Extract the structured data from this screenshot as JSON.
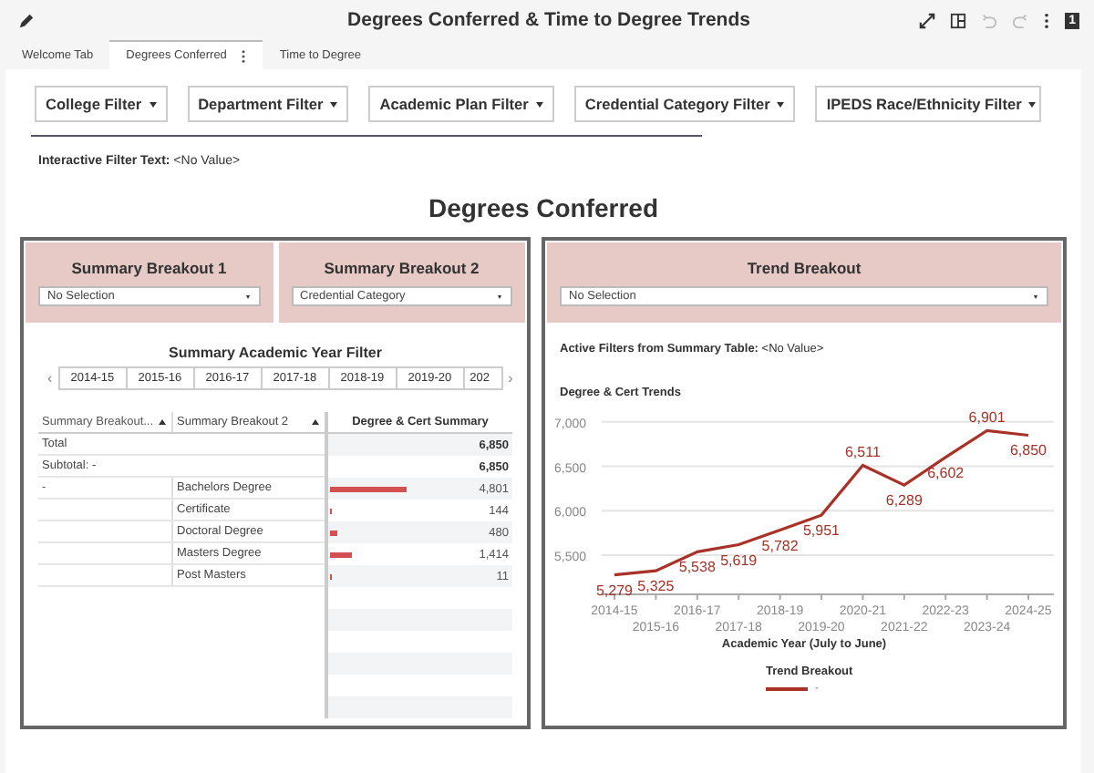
{
  "header": {
    "title": "Degrees Conferred & Time to Degree Trends",
    "page_badge": "1"
  },
  "tabs": [
    {
      "label": "Welcome Tab",
      "selected": false
    },
    {
      "label": "Degrees Conferred",
      "selected": true
    },
    {
      "label": "Time to Degree",
      "selected": false
    }
  ],
  "filters": [
    "College Filter",
    "Department Filter",
    "Academic Plan Filter",
    "Credential Category Filter",
    "IPEDS Race/Ethnicity Filter"
  ],
  "interactive_filter": {
    "label": "Interactive Filter Text:",
    "value": "<No Value>"
  },
  "section_title": "Degrees Conferred",
  "left_panel": {
    "breakouts": [
      {
        "title": "Summary Breakout 1",
        "value": "No Selection"
      },
      {
        "title": "Summary Breakout 2",
        "value": "Credential Category"
      }
    ],
    "year_filter": {
      "title": "Summary Academic Year Filter",
      "prev": "‹",
      "next": "›",
      "years": [
        "2014-15",
        "2015-16",
        "2016-17",
        "2017-18",
        "2018-19",
        "2019-20",
        "202"
      ]
    },
    "table": {
      "columns": [
        "Summary Breakout...",
        "Summary Breakout 2",
        "Degree & Cert Summary"
      ],
      "rows": [
        {
          "kind": "total",
          "label": "Total",
          "value": "6,850"
        },
        {
          "kind": "total",
          "label": "Subtotal: -",
          "value": "6,850"
        },
        {
          "kind": "detail",
          "group": "-",
          "label": "Bachelors Degree",
          "value": "4,801"
        },
        {
          "kind": "detail",
          "label": "Certificate",
          "value": "144"
        },
        {
          "kind": "detail",
          "label": "Doctoral Degree",
          "value": "480"
        },
        {
          "kind": "detail",
          "label": "Masters Degree",
          "value": "1,414"
        },
        {
          "kind": "detail",
          "label": "Post Masters",
          "value": "11"
        }
      ]
    }
  },
  "right_panel": {
    "breakout": {
      "title": "Trend Breakout",
      "value": "No Selection"
    },
    "active_filters": {
      "label": "Active Filters from Summary Table:",
      "value": "<No Value>"
    },
    "chart_data": {
      "type": "line",
      "title": "Degree & Cert Trends",
      "xlabel": "Academic Year (July to June)",
      "categories": [
        "2014-15",
        "2015-16",
        "2016-17",
        "2017-18",
        "2018-19",
        "2019-20",
        "2020-21",
        "2021-22",
        "2022-23",
        "2023-24",
        "2024-25"
      ],
      "series": [
        {
          "name": "-",
          "color": "#a83228",
          "values": [
            5279,
            5325,
            5538,
            5619,
            5782,
            5951,
            6511,
            6289,
            6602,
            6901,
            6850
          ]
        }
      ],
      "ylim": [
        5060,
        7050
      ],
      "yticks": [
        {
          "value": 5500,
          "label": "5,500"
        },
        {
          "value": 6000,
          "label": "6,000"
        },
        {
          "value": 6500,
          "label": "6,500"
        },
        {
          "value": 7000,
          "label": "7,000"
        }
      ],
      "grid": true,
      "value_labels": [
        "5,279",
        "5,325",
        "5,538",
        "5,619",
        "5,782",
        "5,951",
        "6,511",
        "6,289",
        "6,602",
        "6,901",
        "6,850"
      ]
    },
    "legend_title": "Trend Breakout"
  }
}
